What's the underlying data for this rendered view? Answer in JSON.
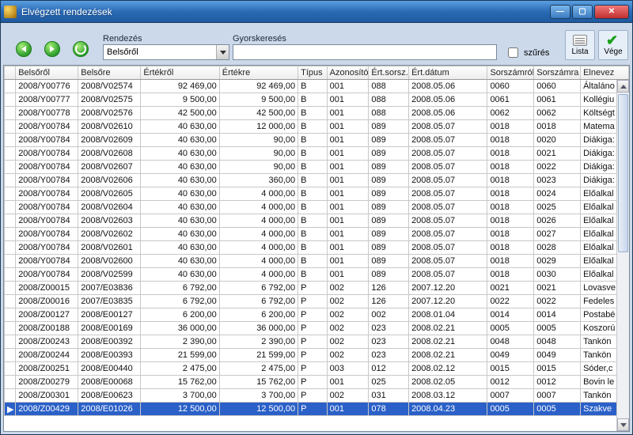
{
  "window": {
    "title": "Elvégzett rendezések"
  },
  "toolbar": {
    "sort_label": "Rendezés",
    "sort_value": "Belsőről",
    "search_label": "Gyorskeresés",
    "search_value": "",
    "filter_label": "szűrés",
    "filter_checked": false,
    "list_btn": "Lista",
    "done_btn": "Vége"
  },
  "columns": [
    "",
    "Belsőről",
    "Belsőre",
    "Értékről",
    "Értékre",
    "Típus",
    "Azonosító",
    "Ért.sorsz.",
    "Ért.dátum",
    "Sorszámról",
    "Sorszámra",
    "Elnevez"
  ],
  "chart_data": {
    "type": "table",
    "columns": [
      "Belsőről",
      "Belsőre",
      "Értékről",
      "Értékre",
      "Típus",
      "Azonosító",
      "Ért.sorsz.",
      "Ért.dátum",
      "Sorszámról",
      "Sorszámra",
      "Elnevezés"
    ],
    "rows": [
      [
        "2008/Y00776",
        "2008/V02574",
        "92 469,00",
        "92 469,00",
        "B",
        "001",
        "088",
        "2008.05.06",
        "0060",
        "0060",
        "Általáno"
      ],
      [
        "2008/Y00777",
        "2008/V02575",
        "9 500,00",
        "9 500,00",
        "B",
        "001",
        "088",
        "2008.05.06",
        "0061",
        "0061",
        "Kollégiu"
      ],
      [
        "2008/Y00778",
        "2008/V02576",
        "42 500,00",
        "42 500,00",
        "B",
        "001",
        "088",
        "2008.05.06",
        "0062",
        "0062",
        "Költségt"
      ],
      [
        "2008/Y00784",
        "2008/V02610",
        "40 630,00",
        "12 000,00",
        "B",
        "001",
        "089",
        "2008.05.07",
        "0018",
        "0018",
        "Matema"
      ],
      [
        "2008/Y00784",
        "2008/V02609",
        "40 630,00",
        "90,00",
        "B",
        "001",
        "089",
        "2008.05.07",
        "0018",
        "0020",
        "Diákiga:"
      ],
      [
        "2008/Y00784",
        "2008/V02608",
        "40 630,00",
        "90,00",
        "B",
        "001",
        "089",
        "2008.05.07",
        "0018",
        "0021",
        "Diákiga:"
      ],
      [
        "2008/Y00784",
        "2008/V02607",
        "40 630,00",
        "90,00",
        "B",
        "001",
        "089",
        "2008.05.07",
        "0018",
        "0022",
        "Diákiga:"
      ],
      [
        "2008/Y00784",
        "2008/V02606",
        "40 630,00",
        "360,00",
        "B",
        "001",
        "089",
        "2008.05.07",
        "0018",
        "0023",
        "Diákiga:"
      ],
      [
        "2008/Y00784",
        "2008/V02605",
        "40 630,00",
        "4 000,00",
        "B",
        "001",
        "089",
        "2008.05.07",
        "0018",
        "0024",
        "Előalkal"
      ],
      [
        "2008/Y00784",
        "2008/V02604",
        "40 630,00",
        "4 000,00",
        "B",
        "001",
        "089",
        "2008.05.07",
        "0018",
        "0025",
        "Előalkal"
      ],
      [
        "2008/Y00784",
        "2008/V02603",
        "40 630,00",
        "4 000,00",
        "B",
        "001",
        "089",
        "2008.05.07",
        "0018",
        "0026",
        "Előalkal"
      ],
      [
        "2008/Y00784",
        "2008/V02602",
        "40 630,00",
        "4 000,00",
        "B",
        "001",
        "089",
        "2008.05.07",
        "0018",
        "0027",
        "Előalkal"
      ],
      [
        "2008/Y00784",
        "2008/V02601",
        "40 630,00",
        "4 000,00",
        "B",
        "001",
        "089",
        "2008.05.07",
        "0018",
        "0028",
        "Előalkal"
      ],
      [
        "2008/Y00784",
        "2008/V02600",
        "40 630,00",
        "4 000,00",
        "B",
        "001",
        "089",
        "2008.05.07",
        "0018",
        "0029",
        "Előalkal"
      ],
      [
        "2008/Y00784",
        "2008/V02599",
        "40 630,00",
        "4 000,00",
        "B",
        "001",
        "089",
        "2008.05.07",
        "0018",
        "0030",
        "Előalkal"
      ],
      [
        "2008/Z00015",
        "2007/E03836",
        "6 792,00",
        "6 792,00",
        "P",
        "002",
        "126",
        "2007.12.20",
        "0021",
        "0021",
        "Lovasve"
      ],
      [
        "2008/Z00016",
        "2007/E03835",
        "6 792,00",
        "6 792,00",
        "P",
        "002",
        "126",
        "2007.12.20",
        "0022",
        "0022",
        "Fedeles"
      ],
      [
        "2008/Z00127",
        "2008/E00127",
        "6 200,00",
        "6 200,00",
        "P",
        "002",
        "002",
        "2008.01.04",
        "0014",
        "0014",
        "Postabé"
      ],
      [
        "2008/Z00188",
        "2008/E00169",
        "36 000,00",
        "36 000,00",
        "P",
        "002",
        "023",
        "2008.02.21",
        "0005",
        "0005",
        "Koszorú"
      ],
      [
        "2008/Z00243",
        "2008/E00392",
        "2 390,00",
        "2 390,00",
        "P",
        "002",
        "023",
        "2008.02.21",
        "0048",
        "0048",
        "Tankön"
      ],
      [
        "2008/Z00244",
        "2008/E00393",
        "21 599,00",
        "21 599,00",
        "P",
        "002",
        "023",
        "2008.02.21",
        "0049",
        "0049",
        "Tankön"
      ],
      [
        "2008/Z00251",
        "2008/E00440",
        "2 475,00",
        "2 475,00",
        "P",
        "003",
        "012",
        "2008.02.12",
        "0015",
        "0015",
        "Sóder,c"
      ],
      [
        "2008/Z00279",
        "2008/E00068",
        "15 762,00",
        "15 762,00",
        "P",
        "001",
        "025",
        "2008.02.05",
        "0012",
        "0012",
        "Bovin le"
      ],
      [
        "2008/Z00301",
        "2008/E00623",
        "3 700,00",
        "3 700,00",
        "P",
        "002",
        "031",
        "2008.03.12",
        "0007",
        "0007",
        "Tankön"
      ],
      [
        "2008/Z00429",
        "2008/E01026",
        "12 500,00",
        "12 500,00",
        "P",
        "001",
        "078",
        "2008.04.23",
        "0005",
        "0005",
        "Szakve"
      ]
    ],
    "selected_index": 24
  }
}
